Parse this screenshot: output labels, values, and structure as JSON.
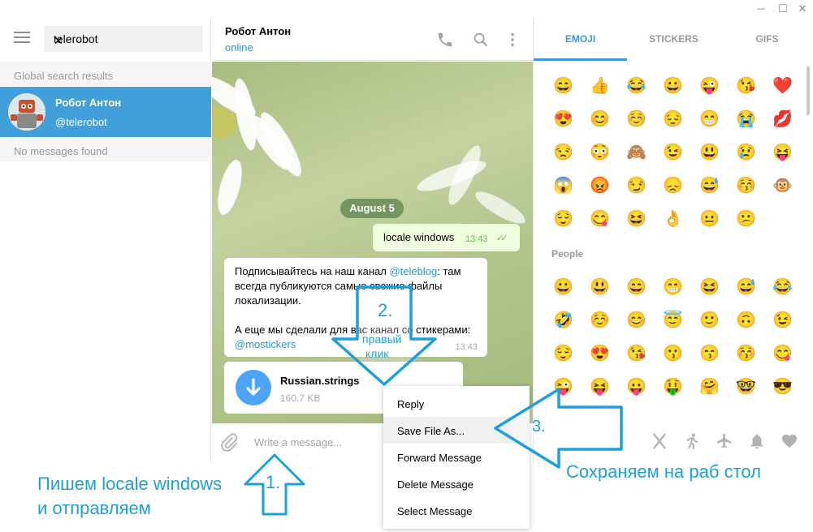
{
  "window_controls": {
    "minimize": "─",
    "maximize": "☐",
    "close": "✕"
  },
  "left": {
    "search_value": "telerobot",
    "global_results_header": "Global search results",
    "result": {
      "name": "Робот Антон",
      "username": "@telerobot"
    },
    "no_messages": "No messages found"
  },
  "chat": {
    "title": "Робот Антон",
    "status": "online",
    "date": "August 5",
    "out_msg": {
      "text": "locale windows",
      "time": "13:43",
      "check": "✓✓"
    },
    "in_msg": {
      "line1a": "Подписывайтесь на наш канал ",
      "link1": "@teleblog",
      "line1b": ": там всегда публикуются самые свежие файлы локализации.",
      "line2a": "А еще мы сделали для вас канал со стикерами: ",
      "link2": "@mostickers",
      "time": "13:43"
    },
    "file": {
      "name": "Russian.strings",
      "size": "160.7 KB"
    },
    "compose_placeholder": "Write a message..."
  },
  "right": {
    "tabs": [
      "EMOJI",
      "STICKERS",
      "GIFS"
    ],
    "emoji_rows": [
      [
        "😄",
        "👍",
        "😂",
        "😀",
        "😜",
        "😘",
        "❤️"
      ],
      [
        "😍",
        "😊",
        "☺️",
        "😔",
        "😁",
        "😭",
        "💋"
      ],
      [
        "😒",
        "😳",
        "🙈",
        "😉",
        "😃",
        "😢",
        "😝"
      ],
      [
        "😱",
        "😡",
        "😏",
        "😞",
        "😅",
        "😚",
        "🐵"
      ],
      [
        "😌",
        "😋",
        "😆",
        "👌",
        "😐",
        "😕"
      ]
    ],
    "people_header": "People",
    "people_rows": [
      [
        "😀",
        "😃",
        "😄",
        "😁",
        "😆",
        "😅",
        "😂"
      ],
      [
        "🤣",
        "☺️",
        "😊",
        "😇",
        "🙂",
        "🙃",
        "😉"
      ],
      [
        "😌",
        "😍",
        "😘",
        "😗",
        "😙",
        "😚",
        "😋"
      ],
      [
        "😜",
        "😝",
        "😛",
        "🤑",
        "🤗",
        "🤓",
        "😎"
      ]
    ]
  },
  "context_menu": {
    "items": [
      "Reply",
      "Save File As...",
      "Forward Message",
      "Delete Message",
      "Select Message"
    ],
    "highlighted": 1
  },
  "annotations": {
    "step1_label": "Пишем locale windows",
    "step1_label2": "и отправляем",
    "step1_num": "1.",
    "step2_num": "2.",
    "step2_text1": "правый",
    "step2_text2": "клик",
    "step3_num": "3.",
    "step3_label": "Сохраняем на раб стол",
    "color": "#1d9fd9"
  }
}
